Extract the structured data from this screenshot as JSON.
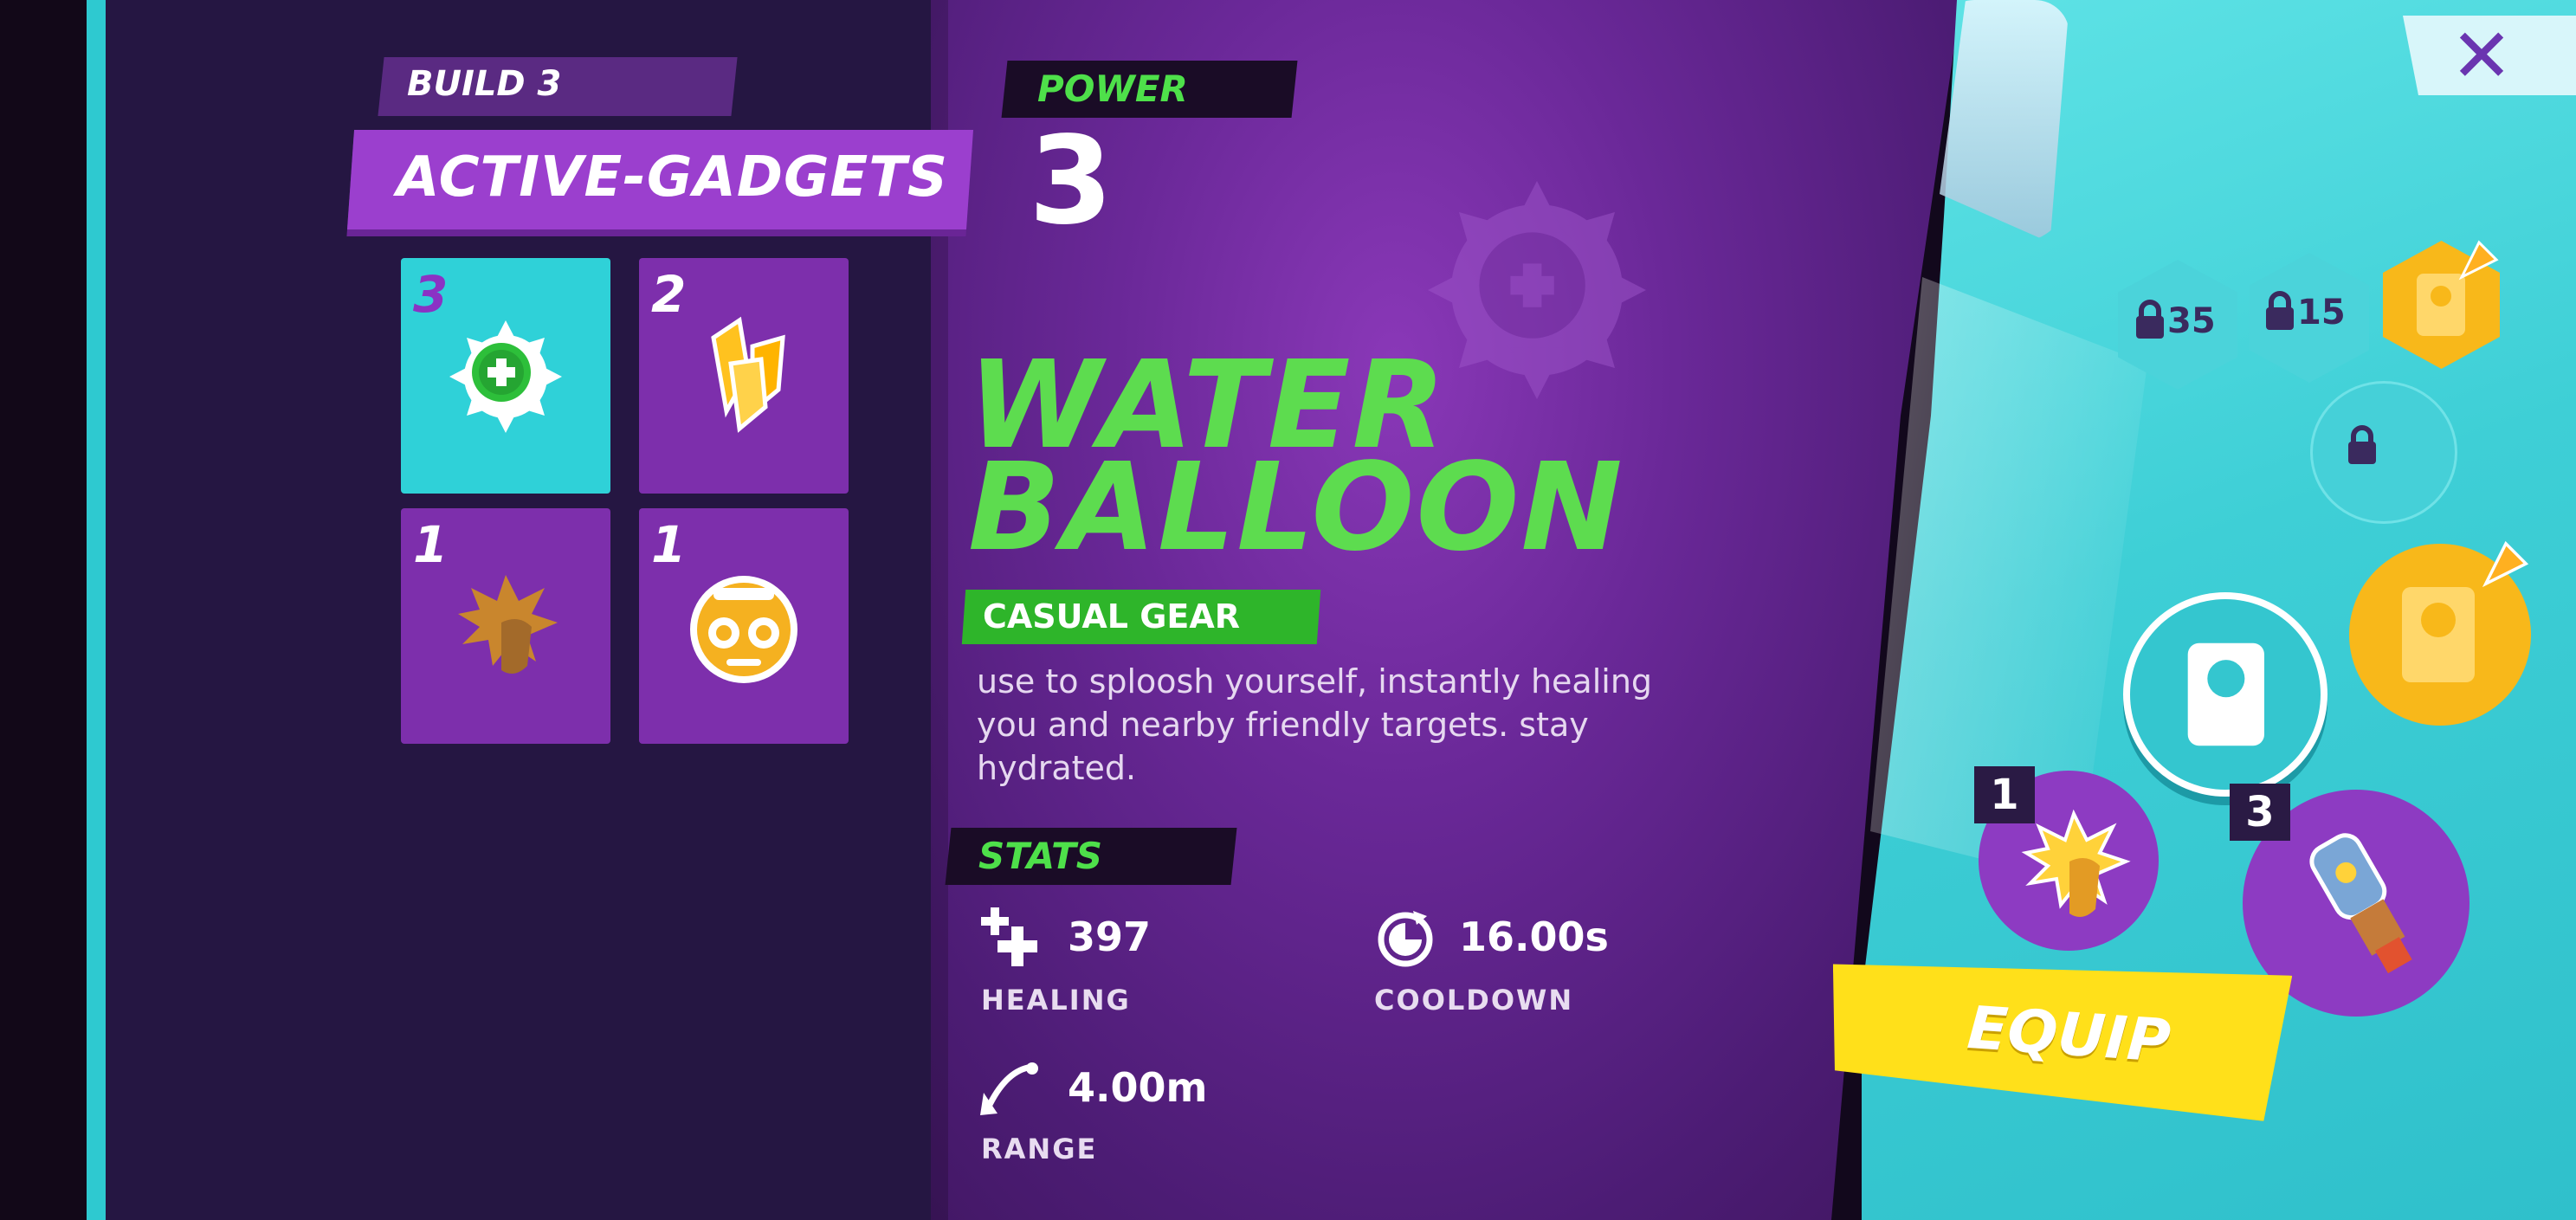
{
  "build": {
    "label": "BUILD 3",
    "category": "ACTIVE-GADGETS"
  },
  "gadget_tiles": [
    {
      "count": "3",
      "icon": "water-balloon-icon",
      "selected": true
    },
    {
      "count": "2",
      "icon": "crystal-shards-icon",
      "selected": false
    },
    {
      "count": "1",
      "icon": "punch-fist-icon",
      "selected": false
    },
    {
      "count": "1",
      "icon": "boombox-icon",
      "selected": false
    }
  ],
  "power": {
    "label": "POWER",
    "value": "3"
  },
  "item": {
    "title_line1": "WATER",
    "title_line2": "BALLOON",
    "rarity": "CASUAL GEAR",
    "description": "use to sploosh yourself, instantly healing you and nearby friendly targets. stay hydrated."
  },
  "stats": {
    "header": "STATS",
    "healing": {
      "value": "397",
      "label": "HEALING",
      "icon": "healing-plus-icon"
    },
    "cooldown": {
      "value": "16.00s",
      "label": "COOLDOWN",
      "icon": "cooldown-clock-icon"
    },
    "range": {
      "value": "4.00m",
      "label": "RANGE",
      "icon": "range-arc-icon"
    }
  },
  "right": {
    "close_icon": "✕",
    "lock_slots": [
      "35",
      "15"
    ],
    "equip_label": "EQUIP",
    "loadout_slots": [
      {
        "count": "1",
        "icon": "punch-fist-icon"
      },
      {
        "count": "3",
        "icon": "laser-gauntlet-icon"
      }
    ]
  },
  "colors": {
    "accent_green": "#5ddc4f",
    "accent_purple": "#9b3fce",
    "accent_cyan": "#2fd1d8",
    "equip_yellow": "#ffe01a",
    "rarity_green": "#2eb52a"
  }
}
